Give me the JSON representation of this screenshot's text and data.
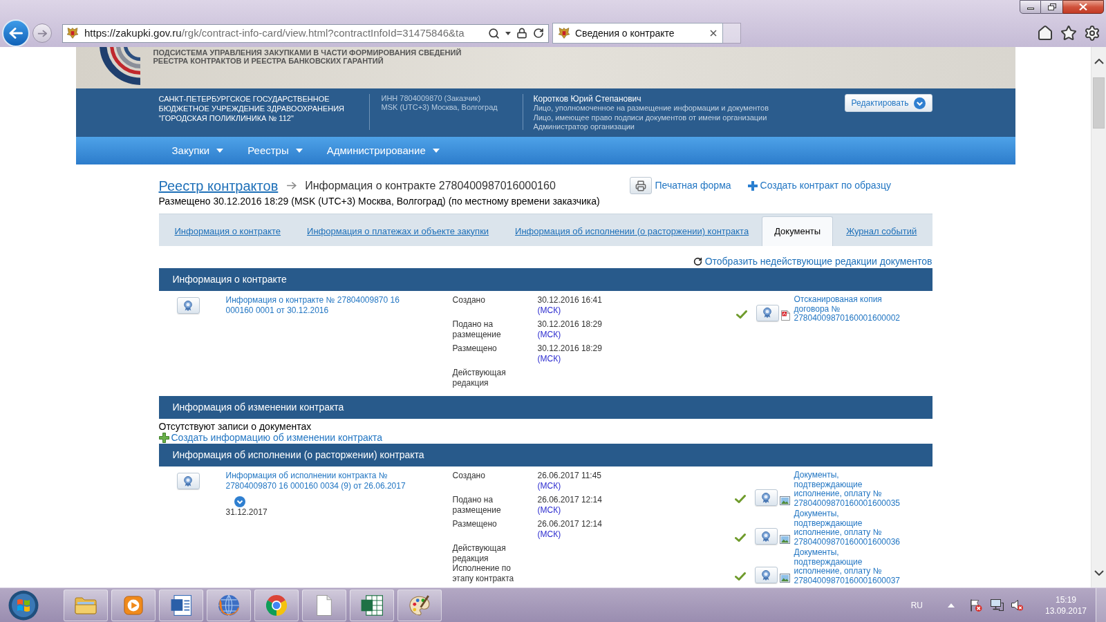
{
  "browser": {
    "url_host": "https://zakupki.gov.ru",
    "url_path": "/rgk/contract-info-card/view.html?contractInfoId=31475846&ta",
    "tabs": [
      {
        "title": "Сведения о контракте",
        "selected": true
      }
    ]
  },
  "site_header": {
    "title_lines": [
      "ПОДСИСТЕМА УПРАВЛЕНИЯ ЗАКУПКАМИ В ЧАСТИ ФОРМИРОВАНИЯ СВЕДЕНИЙ",
      "РЕЕСТРА КОНТРАКТОВ И РЕЕСТРА БАНКОВСКИХ ГАРАНТИЙ"
    ]
  },
  "organization": {
    "name": "САНКТ-ПЕТЕРБУРГСКОЕ ГОСУДАРСТВЕННОЕ БЮДЖЕТНОЕ УЧРЕЖДЕНИЕ ЗДРАВООХРАНЕНИЯ \"ГОРОДСКАЯ ПОЛИКЛИНИКА № 112\"",
    "details": [
      "ИНН 7804009870 (Заказчик)",
      "MSK (UTC+3) Москва, Волгоград"
    ],
    "user_name": "Коротков Юрий Степанович",
    "user_roles": [
      "Лицо, уполномоченное на размещение информации и документов",
      "Лицо, имеющее право подписи документов от имени организации",
      "Администратор организации"
    ],
    "edit_button": "Редактировать"
  },
  "nav": [
    {
      "label": "Закупки"
    },
    {
      "label": "Реестры"
    },
    {
      "label": "Администрирование"
    }
  ],
  "breadcrumb": {
    "link": "Реестр контрактов",
    "current": "Информация о контракте 2780400987016000160"
  },
  "actions": [
    {
      "kind": "print",
      "label": "Печатная форма"
    },
    {
      "kind": "create",
      "label": "Создать контракт по образцу"
    }
  ],
  "published_note": "Размещено 30.12.2016 18:29 (MSK (UTC+3) Москва, Волгоград) (по местному времени заказчика)",
  "tabs": [
    {
      "label": "Информация о контракте",
      "selected": false
    },
    {
      "label": "Информация о платежах и объекте закупки",
      "selected": false
    },
    {
      "label": "Информация об исполнении (о расторжении) контракта",
      "selected": false
    },
    {
      "label": "Документы",
      "selected": true
    },
    {
      "label": "Журнал событий",
      "selected": false
    }
  ],
  "inactive_versions_link": "Отобразить недействующие редакции документов",
  "sections": [
    {
      "title": "Информация о контракте",
      "records": [
        {
          "link": "Информация о контракте № 27804009870 16 000160 0001 от 30.12.2016",
          "fields": [
            {
              "label": "Создано",
              "value": "30.12.2016 16:41",
              "zone": "(МСК)"
            },
            {
              "label": "Подано на размещение",
              "value": "30.12.2016 18:29",
              "zone": "(МСК)"
            },
            {
              "label": "Размещено",
              "value": "30.12.2016 18:29",
              "zone": "(МСК)"
            },
            {
              "label": "Действующая редакция"
            }
          ],
          "documents": [
            {
              "kind": "pdf",
              "title": "Отсканированая копия договора № 27804009870160001600002",
              "verified": true
            }
          ]
        }
      ]
    },
    {
      "title": "Информация об изменении контракта",
      "empty_text": "Отсутствуют записи о документах",
      "create_link": "Создать информацию об изменении контракта"
    },
    {
      "title": "Информация об исполнении (о расторжении) контракта",
      "records": [
        {
          "link": "Информация об исполнении контракта № 27804009870 16 000160 0034 (9) от 26.06.2017",
          "date": "31.12.2017",
          "fields": [
            {
              "label": "Создано",
              "value": "26.06.2017 11:45",
              "zone": "(МСК)"
            },
            {
              "label": "Подано на размещение",
              "value": "26.06.2017 12:14",
              "zone": "(МСК)"
            },
            {
              "label": "Размещено",
              "value": "26.06.2017 12:14",
              "zone": "(МСК)"
            },
            {
              "label": "Действующая редакция"
            }
          ],
          "status": "Исполнение по этапу контракта",
          "documents": [
            {
              "kind": "image",
              "title": "Документы, подтверждающие исполнение, оплату № 27804009870160001600035",
              "verified": true
            },
            {
              "kind": "image",
              "title": "Документы, подтверждающие исполнение, оплату № 27804009870160001600036",
              "verified": true
            },
            {
              "kind": "image",
              "title": "Документы, подтверждающие исполнение, оплату № 27804009870160001600037",
              "verified": true
            }
          ]
        }
      ]
    }
  ],
  "taskbar": {
    "language": "RU",
    "time": "15:19",
    "date": "13.09.2017"
  }
}
